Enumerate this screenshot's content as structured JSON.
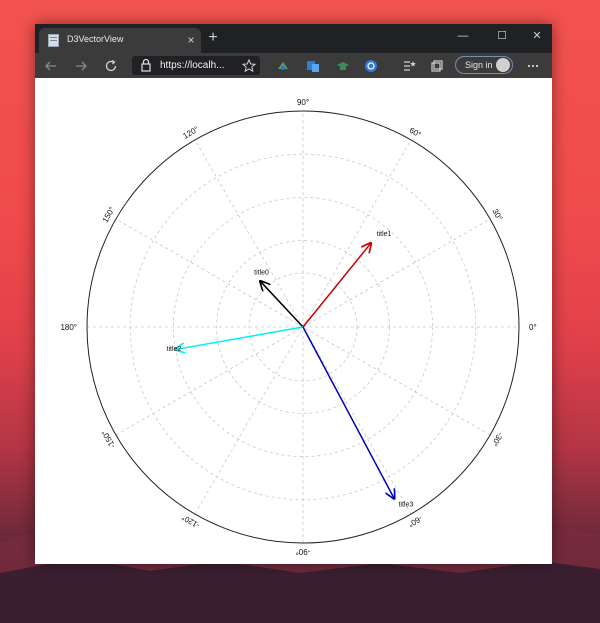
{
  "window": {
    "tab_title": "D3VectorView",
    "tab_close": "×",
    "new_tab": "+",
    "controls": [
      "—",
      "☐",
      "✕"
    ]
  },
  "toolbar": {
    "url": "https://localh...",
    "sign_in_label": "Sign in",
    "icons": [
      "back-icon",
      "forward-icon",
      "refresh-icon",
      "lock-icon",
      "favorite-star-icon",
      "extension-icon",
      "translate-icon",
      "graduation-icon",
      "circle-extension-icon",
      "favorites-list-icon",
      "collections-icon",
      "more-icon"
    ]
  },
  "chart_data": {
    "type": "polar-vector",
    "radial_ticks": [
      "",
      "",
      "",
      "",
      ""
    ],
    "angle_labels": [
      {
        "angle": 0,
        "label": "0°"
      },
      {
        "angle": 30,
        "label": "30°"
      },
      {
        "angle": 60,
        "label": "60°"
      },
      {
        "angle": 90,
        "label": "90°"
      },
      {
        "angle": 120,
        "label": "120°"
      },
      {
        "angle": 150,
        "label": "150°"
      },
      {
        "angle": 180,
        "label": "180°"
      },
      {
        "angle": -150,
        "label": "-150°"
      },
      {
        "angle": -120,
        "label": "-120°"
      },
      {
        "angle": -90,
        "label": "-90°"
      },
      {
        "angle": -60,
        "label": "-60°"
      },
      {
        "angle": -30,
        "label": "-30°"
      }
    ],
    "series": [
      {
        "name": "title0",
        "angle": 133,
        "magnitude": 0.29,
        "color": "#000000"
      },
      {
        "name": "title1",
        "angle": 51,
        "magnitude": 0.5,
        "color": "#cc0000"
      },
      {
        "name": "title2",
        "angle": 190,
        "magnitude": 0.6,
        "color": "#00f2f2"
      },
      {
        "name": "title3",
        "angle": -62,
        "magnitude": 0.9,
        "color": "#0000b3"
      }
    ],
    "grid": true
  }
}
